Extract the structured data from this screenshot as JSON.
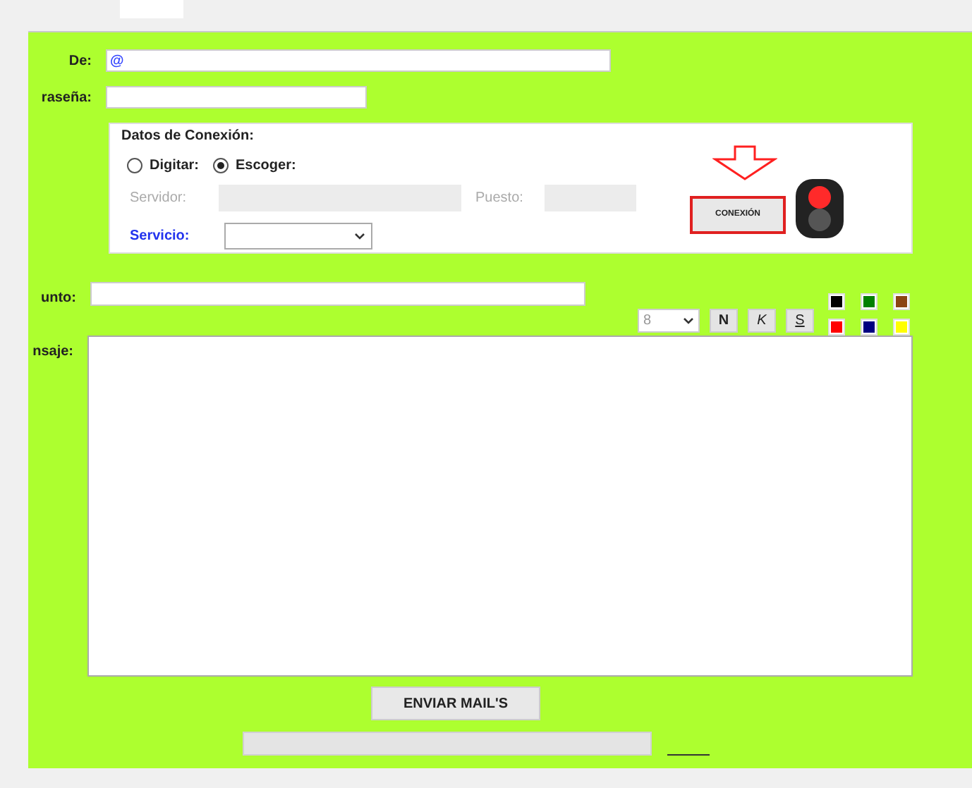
{
  "form": {
    "from": {
      "label": "De:",
      "value": "@"
    },
    "password": {
      "label": "raseña:"
    },
    "connection": {
      "legend": "Datos de Conexión:",
      "modes": [
        {
          "label": "Digitar:",
          "selected": false
        },
        {
          "label": "Escoger:",
          "selected": true
        }
      ],
      "server": {
        "label": "Servidor:",
        "disabled": true
      },
      "port": {
        "label": "Puesto:",
        "disabled": true
      },
      "service": {
        "label": "Servicio:"
      },
      "connect_button": "CONEXIÓN",
      "connected": false
    },
    "subject": {
      "label": "unto:"
    },
    "font_size": "8",
    "format_buttons": [
      {
        "label": "N",
        "kind": "bold"
      },
      {
        "label": "K",
        "kind": "italic"
      },
      {
        "label": "S",
        "kind": "underline"
      }
    ],
    "colors": [
      {
        "color": "#000000"
      },
      {
        "color": "#008000"
      },
      {
        "color": "#8b4513"
      },
      {
        "color": "#ff0000"
      },
      {
        "color": "#000080"
      },
      {
        "color": "#ffff00"
      }
    ],
    "message": {
      "label": "nsaje:"
    },
    "send_button": "ENVIAR MAIL'S",
    "progress": {
      "level": 0
    }
  }
}
